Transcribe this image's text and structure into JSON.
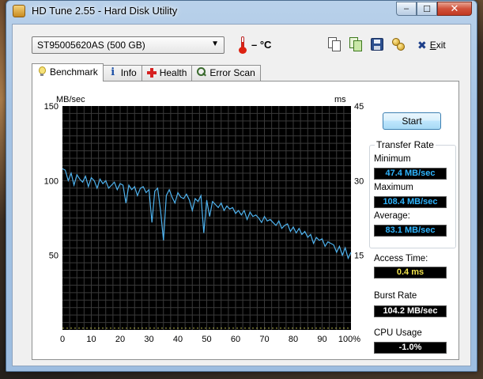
{
  "window": {
    "title": "HD Tune 2.55 - Hard Disk Utility",
    "caption": {
      "minimize": "–",
      "maximize": "☐",
      "close": "✕"
    }
  },
  "toolbar": {
    "drive": "ST95005620AS (500 GB)",
    "temperature": "– °C",
    "exit_prefix": "E",
    "exit_rest": "xit"
  },
  "tabs": [
    {
      "label": "Benchmark",
      "icon": "bulb-icon",
      "active": true
    },
    {
      "label": "Info",
      "icon": "info-icon"
    },
    {
      "label": "Health",
      "icon": "health-icon"
    },
    {
      "label": "Error Scan",
      "icon": "magnifier-icon"
    }
  ],
  "benchmark": {
    "start_label": "Start",
    "transfer_rate_title": "Transfer Rate",
    "minimum_label": "Minimum",
    "minimum_value": "47.4 MB/sec",
    "maximum_label": "Maximum",
    "maximum_value": "108.4 MB/sec",
    "average_label": "Average:",
    "average_value": "83.1 MB/sec",
    "access_label": "Access Time:",
    "access_value": "0.4 ms",
    "burst_label": "Burst Rate",
    "burst_value": "104.2 MB/sec",
    "cpu_label": "CPU Usage",
    "cpu_value": "-1.0%"
  },
  "chart_data": {
    "type": "line",
    "y_unit_left": "MB/sec",
    "y_unit_right": "ms",
    "y_ticks_left": [
      "150",
      "100",
      "50"
    ],
    "y_ticks_right": [
      "45",
      "30",
      "15"
    ],
    "x_ticks": [
      "0",
      "10",
      "20",
      "30",
      "40",
      "50",
      "60",
      "70",
      "80",
      "90",
      "100%"
    ],
    "xlim": [
      0,
      100
    ],
    "ylim": [
      0,
      150
    ],
    "background": "#000000",
    "grid": true,
    "series": [
      {
        "color": "#4fb3ef",
        "x": [
          0,
          1,
          2,
          3,
          4,
          5,
          6,
          7,
          8,
          9,
          10,
          11,
          12,
          13,
          14,
          15,
          16,
          17,
          18,
          19,
          20,
          21,
          22,
          23,
          24,
          25,
          26,
          27,
          28,
          29,
          30,
          31,
          32,
          33,
          34,
          35,
          36,
          37,
          38,
          39,
          40,
          41,
          42,
          43,
          44,
          45,
          46,
          47,
          48,
          49,
          50,
          51,
          52,
          53,
          54,
          55,
          56,
          57,
          58,
          59,
          60,
          61,
          62,
          63,
          64,
          65,
          66,
          67,
          68,
          69,
          70,
          71,
          72,
          73,
          74,
          75,
          76,
          77,
          78,
          79,
          80,
          81,
          82,
          83,
          84,
          85,
          86,
          87,
          88,
          89,
          90,
          91,
          92,
          93,
          94,
          95,
          96,
          97,
          98,
          99,
          100
        ],
        "y": [
          108,
          107,
          100,
          105,
          97,
          104,
          101,
          99,
          103,
          96,
          102,
          100,
          95,
          101,
          98,
          100,
          95,
          97,
          99,
          94,
          98,
          97,
          85,
          97,
          94,
          96,
          90,
          95,
          96,
          92,
          94,
          72,
          93,
          95,
          80,
          60,
          90,
          94,
          89,
          85,
          92,
          89,
          88,
          91,
          87,
          80,
          88,
          86,
          90,
          65,
          87,
          76,
          86,
          84,
          82,
          85,
          80,
          83,
          81,
          82,
          78,
          80,
          77,
          80,
          74,
          79,
          76,
          77,
          75,
          72,
          76,
          73,
          74,
          72,
          70,
          73,
          68,
          70,
          71,
          66,
          69,
          65,
          68,
          64,
          66,
          62,
          64,
          58,
          62,
          60,
          61,
          56,
          59,
          58,
          57,
          52,
          56,
          50,
          55,
          48,
          52
        ]
      }
    ],
    "access_series": {
      "color": "#ffff66",
      "value": 0.4
    }
  }
}
